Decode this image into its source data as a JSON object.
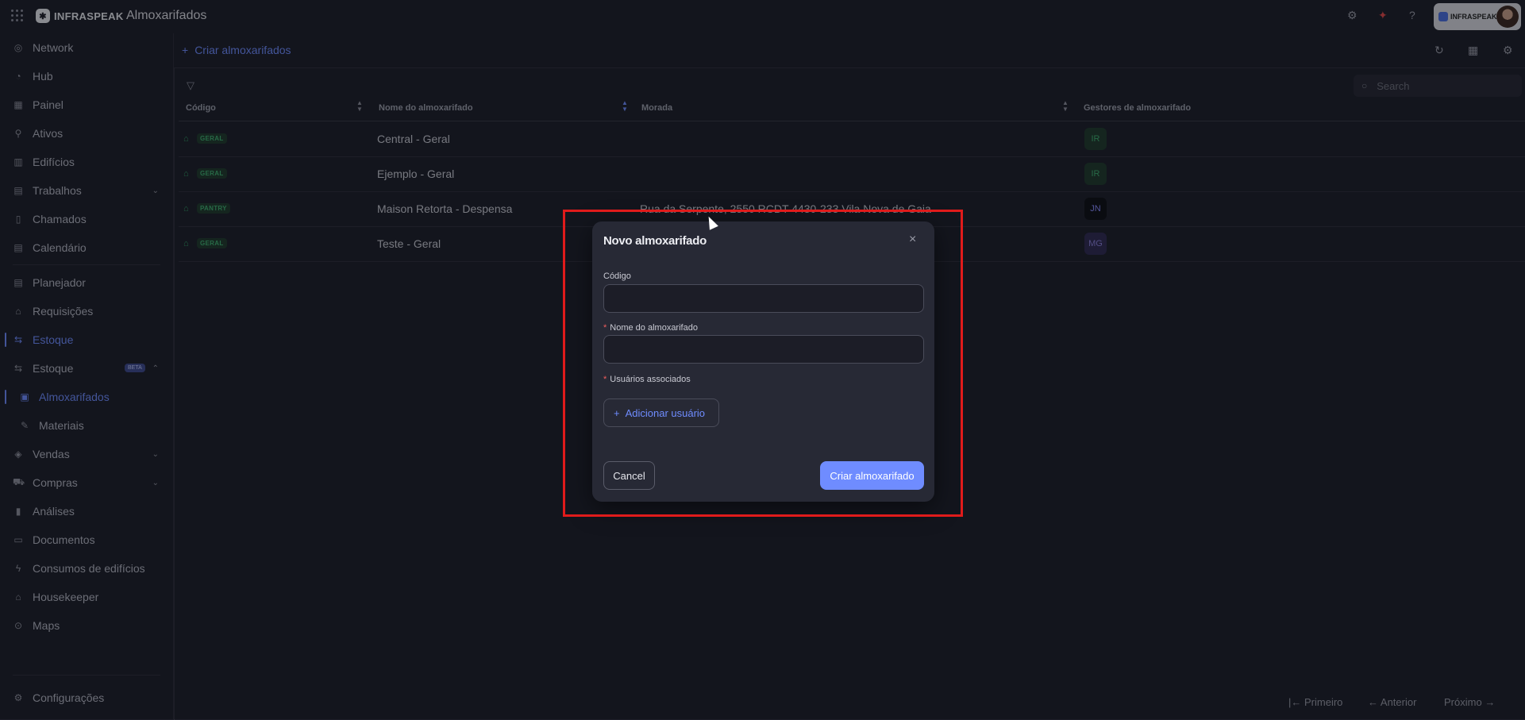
{
  "topbar": {
    "brand": "INFRASPEAK",
    "page_title": "Almoxarifados",
    "account_brand": "INFRASPEAK"
  },
  "sidebar": {
    "items": [
      {
        "label": "Network",
        "icon": "globe-icon"
      },
      {
        "label": "Hub",
        "icon": "compass-icon"
      },
      {
        "label": "Painel",
        "icon": "dashboard-icon"
      },
      {
        "label": "Ativos",
        "icon": "asset-icon"
      },
      {
        "label": "Edifícios",
        "icon": "building-icon"
      },
      {
        "label": "Trabalhos",
        "icon": "calendar-icon",
        "expandable": true
      },
      {
        "label": "Chamados",
        "icon": "clipboard-icon"
      },
      {
        "label": "Calendário",
        "icon": "calendar-icon"
      },
      {
        "label": "Planejador",
        "icon": "planner-icon"
      },
      {
        "label": "Requisições",
        "icon": "request-icon"
      },
      {
        "label": "Estoque",
        "icon": "stock-icon",
        "active": true
      },
      {
        "label": "Estoque",
        "icon": "stock-icon",
        "badge": "BETA",
        "expanded": true
      },
      {
        "label": "Almoxarifados",
        "icon": "warehouse-icon",
        "active": true,
        "sub": true
      },
      {
        "label": "Materiais",
        "icon": "tool-icon",
        "sub": true
      },
      {
        "label": "Vendas",
        "icon": "tag-icon",
        "expandable": true
      },
      {
        "label": "Compras",
        "icon": "cart-icon",
        "expandable": true
      },
      {
        "label": "Análises",
        "icon": "chart-icon"
      },
      {
        "label": "Documentos",
        "icon": "document-icon"
      },
      {
        "label": "Consumos de edifícios",
        "icon": "bolt-icon"
      },
      {
        "label": "Housekeeper",
        "icon": "housekeeper-icon"
      },
      {
        "label": "Maps",
        "icon": "pin-icon"
      }
    ],
    "settings": "Configurações"
  },
  "toolbar": {
    "create_label": "Criar almoxarifados",
    "search_placeholder": "Search"
  },
  "table": {
    "columns": [
      "Código",
      "Nome do almoxarifado",
      "Morada",
      "Gestores de almoxarifado"
    ],
    "rows": [
      {
        "tag": "GERAL",
        "name": "Central - Geral",
        "address": "",
        "manager": "IR",
        "manager_color": "#1f3a2c",
        "manager_text": "#3fae6f"
      },
      {
        "tag": "GERAL",
        "name": "Ejemplo - Geral",
        "address": "",
        "manager": "IR",
        "manager_color": "#1f3a2c",
        "manager_text": "#3fae6f"
      },
      {
        "tag": "PANTRY",
        "name": "Maison Retorta - Despensa",
        "address": "Rua da Serpente, 2550 RCDT 4430-233 Vila Nova de Gaia",
        "manager": "JN",
        "manager_color": "#0d0e14",
        "manager_text": "#8a8cff"
      },
      {
        "tag": "GERAL",
        "name": "Teste - Geral",
        "address": "",
        "manager": "MG",
        "manager_color": "#2f2a52",
        "manager_text": "#8a7fd8"
      }
    ]
  },
  "pagination": {
    "first": "Primeiro",
    "prev": "Anterior",
    "next": "Próximo"
  },
  "modal": {
    "title": "Novo almoxarifado",
    "code_label": "Código",
    "code_value": "",
    "name_label": "Nome do almoxarifado",
    "name_value": "",
    "users_label": "Usuários associados",
    "add_user_label": "Adicionar usuário",
    "cancel_label": "Cancel",
    "create_label": "Criar almoxarifado"
  },
  "colors": {
    "accent": "#6f8cff",
    "background": "#1d1e28",
    "highlight": "#e01b1b"
  }
}
